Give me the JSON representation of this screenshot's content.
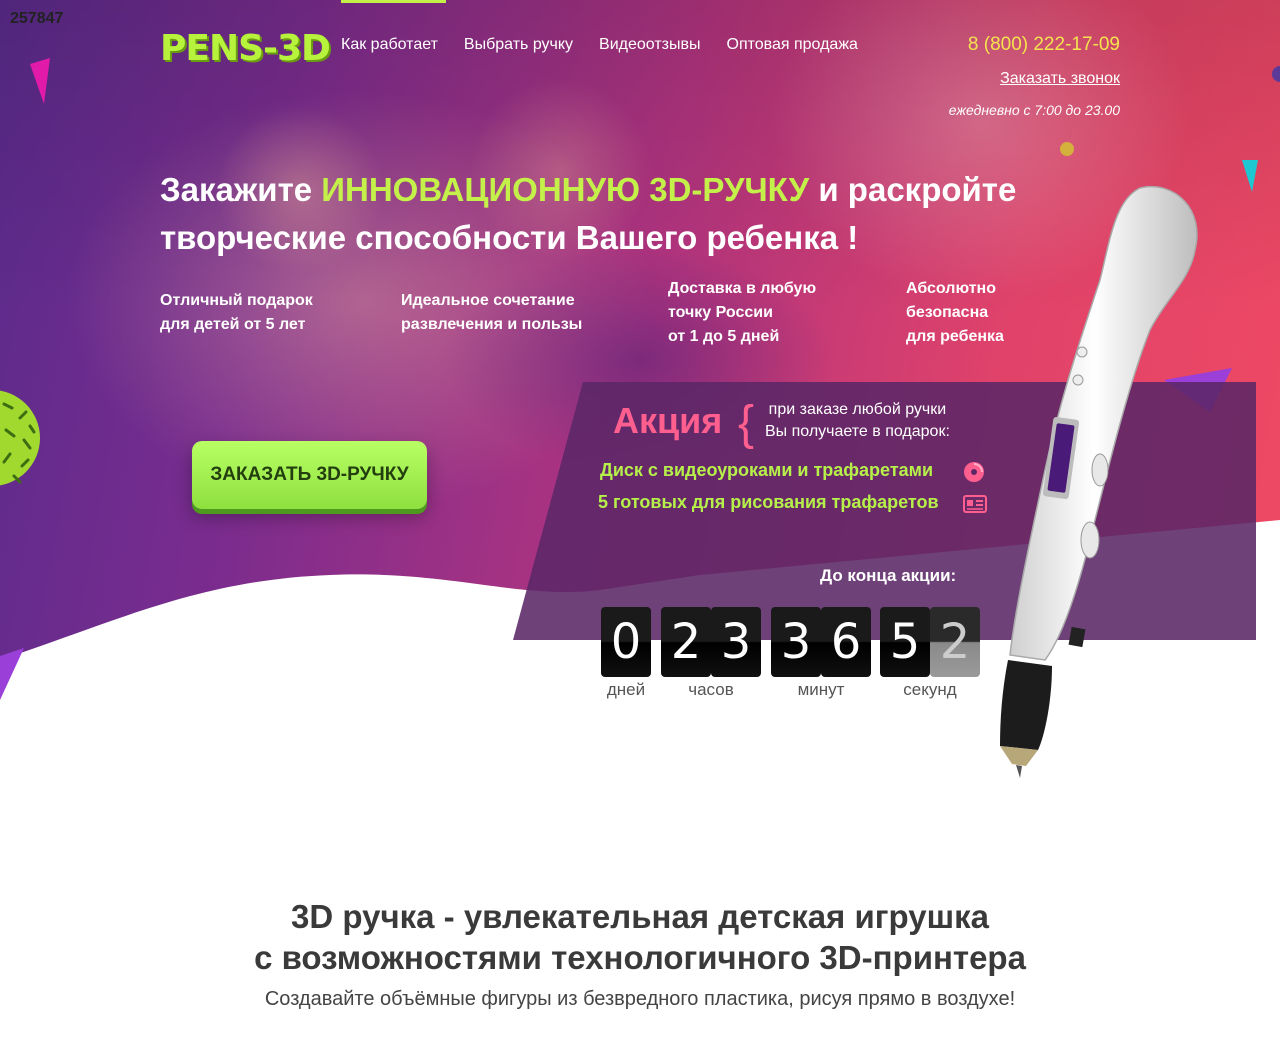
{
  "site_id": "257847",
  "header": {
    "logo": "PENS-3D",
    "nav": [
      "Как работает",
      "Выбрать ручку",
      "Видеоотзывы",
      "Оптовая продажа"
    ],
    "phone": "8 (800) 222-17-09",
    "callback": "Заказать звонок",
    "hours": "ежедневно с 7:00 до 23.00"
  },
  "hero": {
    "headline_pre": "Закажите ",
    "headline_accent": "ИННОВАЦИОННУЮ 3D-РУЧКУ",
    "headline_post": " и раскройте творческие способности Вашего ребенка !",
    "features": [
      "Отличный подарок\nдля детей от 5 лет",
      "Идеальное сочетание\nразвлечения и пользы",
      "Доставка в любую\nточку России\nот 1 до 5 дней",
      "Абсолютно\nбезопасна\nдля ребенка"
    ],
    "order_button": "ЗАКАЗАТЬ 3D-РУЧКУ"
  },
  "promo": {
    "title": "Акция",
    "lead": "при заказе любой ручки\nВы получаете в подарок:",
    "gifts": [
      {
        "text": "Диск с видеоуроками и трафаретами",
        "icon": "disc-icon"
      },
      {
        "text": "5 готовых для рисования трафаретов",
        "icon": "stencil-card-icon"
      }
    ],
    "countdown_label": "До конца акции:",
    "digits": [
      "0",
      "2",
      "3",
      "3",
      "6",
      "5",
      "2"
    ],
    "units": [
      "дней",
      "часов",
      "минут",
      "секунд"
    ]
  },
  "section": {
    "title": "3D ручка - увлекательная детская игрушка\nс возможностями технологичного 3D-принтера",
    "subtitle": "Создавайте объёмные фигуры из безвредного пластика, рисуя прямо в воздухе!"
  },
  "colors": {
    "accent_green": "#c4f04a",
    "phone_yellow": "#f4e34e",
    "promo_pink": "#ff5f8f",
    "button_green": "#8ee03f"
  }
}
